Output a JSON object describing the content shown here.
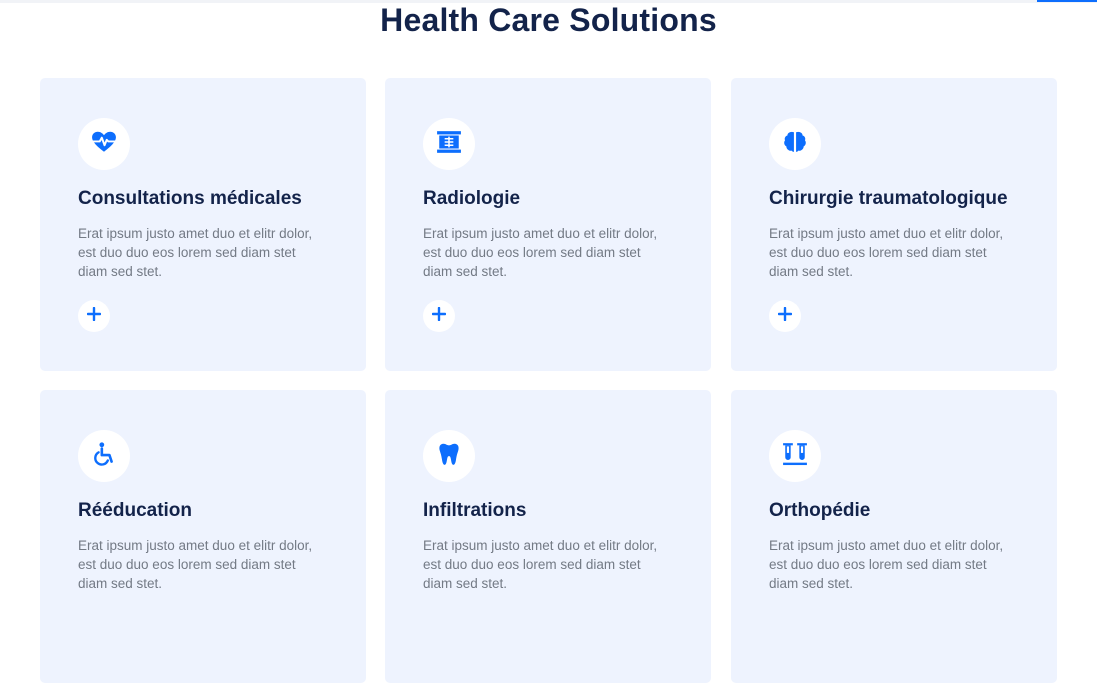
{
  "section": {
    "title": "Health Care Solutions"
  },
  "services": [
    {
      "title": "Consultations médicales",
      "text": "Erat ipsum justo amet duo et elitr dolor, est duo duo eos lorem sed diam stet diam sed stet.",
      "icon": "heart-pulse-icon"
    },
    {
      "title": "Radiologie",
      "text": "Erat ipsum justo amet duo et elitr dolor, est duo duo eos lorem sed diam stet diam sed stet.",
      "icon": "x-ray-icon"
    },
    {
      "title": "Chirurgie traumatologique",
      "text": "Erat ipsum justo amet duo et elitr dolor, est duo duo eos lorem sed diam stet diam sed stet.",
      "icon": "brain-icon"
    },
    {
      "title": "Rééducation",
      "text": "Erat ipsum justo amet duo et elitr dolor, est duo duo eos lorem sed diam stet diam sed stet.",
      "icon": "wheelchair-icon"
    },
    {
      "title": "Infiltrations",
      "text": "Erat ipsum justo amet duo et elitr dolor, est duo duo eos lorem sed diam stet diam sed stet.",
      "icon": "tooth-icon"
    },
    {
      "title": "Orthopédie",
      "text": "Erat ipsum justo amet duo et elitr dolor, est duo duo eos lorem sed diam stet diam sed stet.",
      "icon": "vials-icon"
    }
  ],
  "colors": {
    "accent": "#0d6efd",
    "card_bg": "#eef3fe",
    "heading": "#13234a",
    "body_text": "#737a85"
  }
}
